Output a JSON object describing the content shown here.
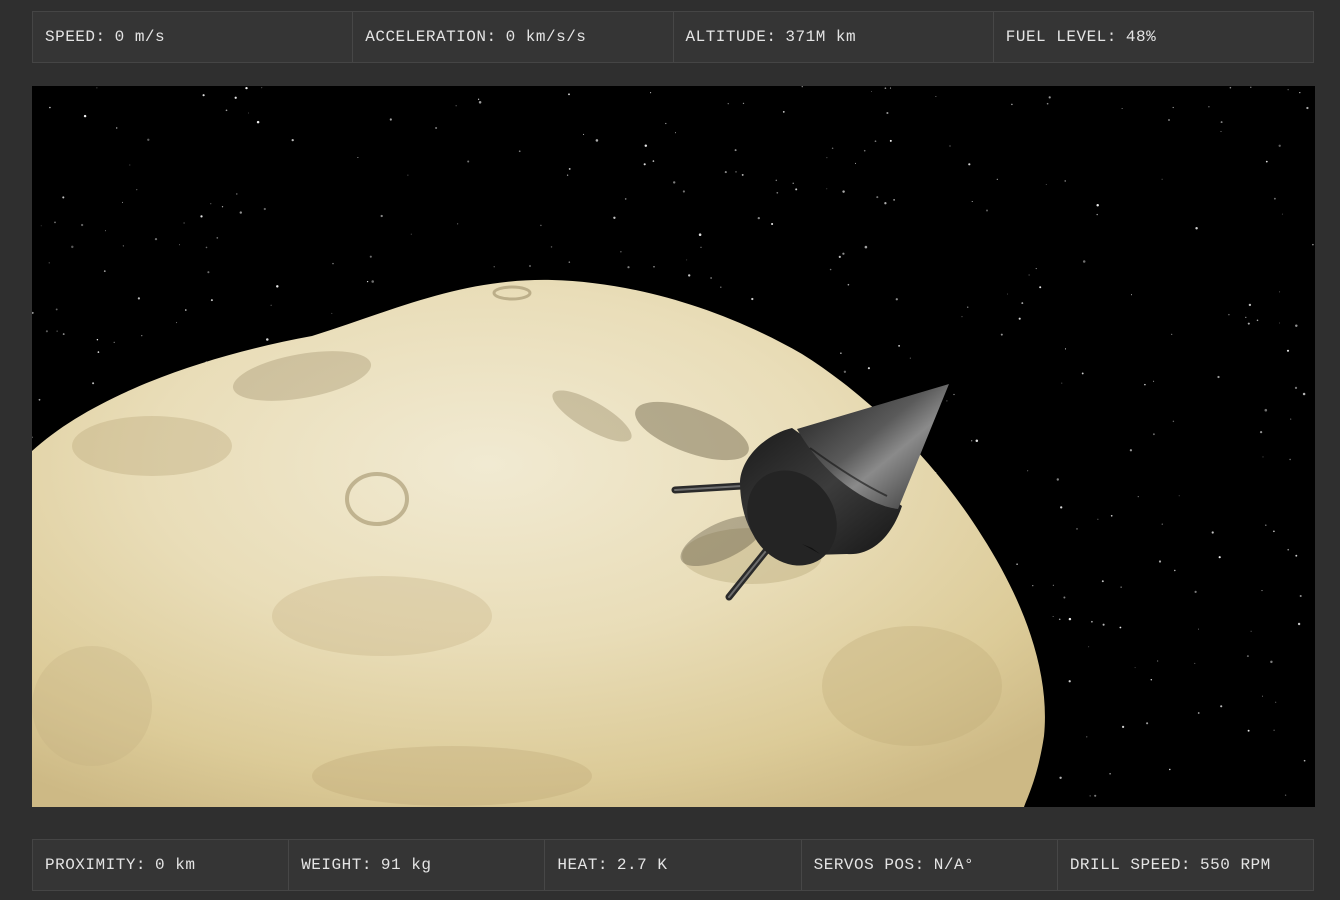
{
  "telemetry_top": [
    {
      "id": "speed",
      "label": "SPEED:",
      "value": "0 m/s"
    },
    {
      "id": "acceleration",
      "label": "ACCELERATION:",
      "value": "0 km/s/s"
    },
    {
      "id": "altitude",
      "label": "ALTITUDE:",
      "value": "371M km"
    },
    {
      "id": "fuel-level",
      "label": "FUEL LEVEL:",
      "value": "48%"
    }
  ],
  "telemetry_bottom": [
    {
      "id": "proximity",
      "label": "PROXIMITY:",
      "value": "0 km"
    },
    {
      "id": "weight",
      "label": "WEIGHT:",
      "value": "91 kg"
    },
    {
      "id": "heat",
      "label": "HEAT:",
      "value": "2.7 K"
    },
    {
      "id": "servos-pos",
      "label": "SERVOS POS:",
      "value": "N/A°"
    },
    {
      "id": "drill-speed",
      "label": "DRILL SPEED:",
      "value": "550 RPM"
    }
  ],
  "scene": {
    "background_color": "#000000",
    "asteroid_color": "#e8dcb8",
    "probe_color": "#3a3a3a"
  }
}
